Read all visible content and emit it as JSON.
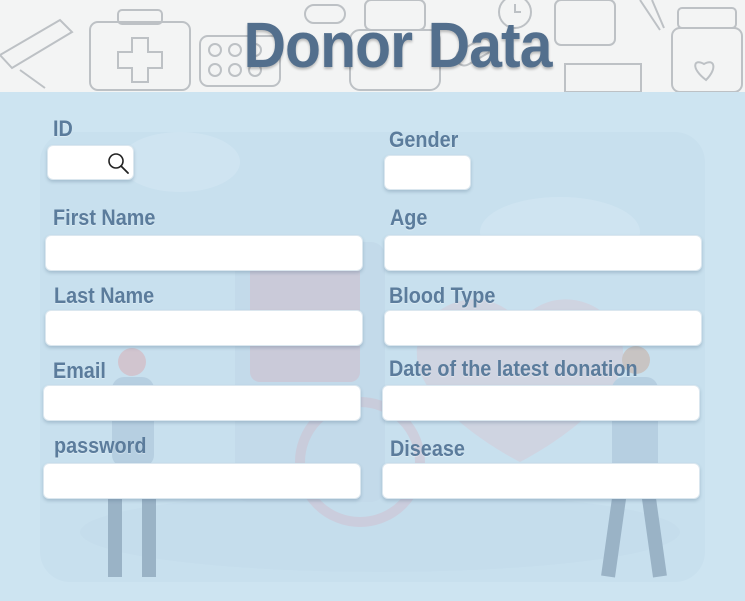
{
  "header": {
    "title": "Donor Data"
  },
  "fields": {
    "id": {
      "label": "ID",
      "value": ""
    },
    "gender": {
      "label": "Gender",
      "value": ""
    },
    "first_name": {
      "label": "First Name",
      "value": ""
    },
    "age": {
      "label": "Age",
      "value": ""
    },
    "last_name": {
      "label": "Last Name",
      "value": ""
    },
    "blood_type": {
      "label": "Blood Type",
      "value": ""
    },
    "email": {
      "label": "Email",
      "value": ""
    },
    "latest_donation": {
      "label": "Date of the latest donation",
      "value": ""
    },
    "password": {
      "label": "password",
      "value": ""
    },
    "disease": {
      "label": "Disease",
      "value": ""
    }
  },
  "icons": {
    "search": "search-icon"
  },
  "colors": {
    "label": "#5b7c9c",
    "title": "#536f8d",
    "background": "#cde4f1"
  }
}
